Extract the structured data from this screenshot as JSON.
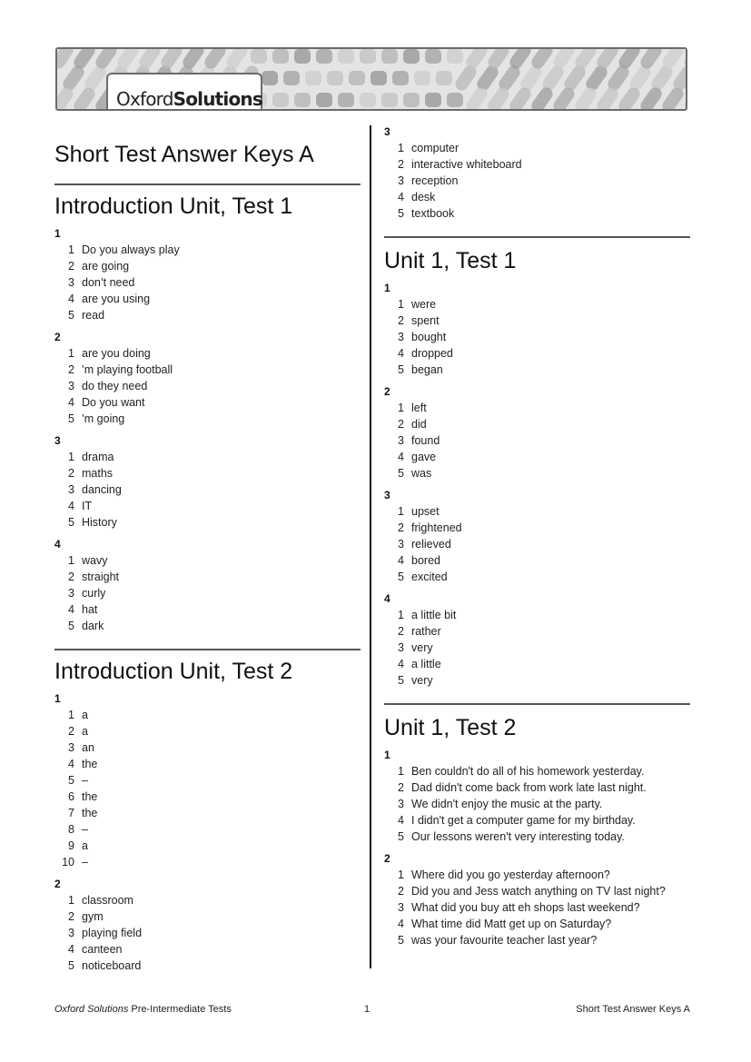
{
  "banner": {
    "brand_regular": "Oxford",
    "brand_bold": "Solutions"
  },
  "document": {
    "title": "Short Test Answer Keys A"
  },
  "sections": {
    "intro1": {
      "title": "Introduction Unit, Test 1",
      "q1": {
        "num": "1",
        "items": [
          [
            "1",
            "Do you always play"
          ],
          [
            "2",
            "are going"
          ],
          [
            "3",
            "don’t need"
          ],
          [
            "4",
            "are you using"
          ],
          [
            "5",
            "read"
          ]
        ]
      },
      "q2": {
        "num": "2",
        "items": [
          [
            "1",
            "are you doing"
          ],
          [
            "2",
            "’m playing football"
          ],
          [
            "3",
            "do they need"
          ],
          [
            "4",
            "Do you want"
          ],
          [
            "5",
            "’m going"
          ]
        ]
      },
      "q3": {
        "num": "3",
        "items": [
          [
            "1",
            "drama"
          ],
          [
            "2",
            "maths"
          ],
          [
            "3",
            "dancing"
          ],
          [
            "4",
            "IT"
          ],
          [
            "5",
            "History"
          ]
        ]
      },
      "q4": {
        "num": "4",
        "items": [
          [
            "1",
            "wavy"
          ],
          [
            "2",
            "straight"
          ],
          [
            "3",
            "curly"
          ],
          [
            "4",
            "hat"
          ],
          [
            "5",
            "dark"
          ]
        ]
      }
    },
    "intro2": {
      "title": "Introduction Unit, Test 2",
      "q1": {
        "num": "1",
        "items": [
          [
            "1",
            "a"
          ],
          [
            "2",
            "a"
          ],
          [
            "3",
            "an"
          ],
          [
            "4",
            "the"
          ],
          [
            "5",
            "–"
          ],
          [
            "6",
            "the"
          ],
          [
            "7",
            "the"
          ],
          [
            "8",
            "–"
          ],
          [
            "9",
            "a"
          ],
          [
            "10",
            "–"
          ]
        ]
      },
      "q2": {
        "num": "2",
        "items": [
          [
            "1",
            "classroom"
          ],
          [
            "2",
            "gym"
          ],
          [
            "3",
            "playing field"
          ],
          [
            "4",
            "canteen"
          ],
          [
            "5",
            "noticeboard"
          ]
        ]
      },
      "q3": {
        "num": "3",
        "items": [
          [
            "1",
            "computer"
          ],
          [
            "2",
            "interactive whiteboard"
          ],
          [
            "3",
            "reception"
          ],
          [
            "4",
            "desk"
          ],
          [
            "5",
            "textbook"
          ]
        ]
      }
    },
    "unit1test1": {
      "title": "Unit 1, Test 1",
      "q1": {
        "num": "1",
        "items": [
          [
            "1",
            "were"
          ],
          [
            "2",
            "spent"
          ],
          [
            "3",
            "bought"
          ],
          [
            "4",
            "dropped"
          ],
          [
            "5",
            "began"
          ]
        ]
      },
      "q2": {
        "num": "2",
        "items": [
          [
            "1",
            "left"
          ],
          [
            "2",
            "did"
          ],
          [
            "3",
            "found"
          ],
          [
            "4",
            "gave"
          ],
          [
            "5",
            "was"
          ]
        ]
      },
      "q3": {
        "num": "3",
        "items": [
          [
            "1",
            "upset"
          ],
          [
            "2",
            "frightened"
          ],
          [
            "3",
            "relieved"
          ],
          [
            "4",
            "bored"
          ],
          [
            "5",
            "excited"
          ]
        ]
      },
      "q4": {
        "num": "4",
        "items": [
          [
            "1",
            "a little bit"
          ],
          [
            "2",
            "rather"
          ],
          [
            "3",
            "very"
          ],
          [
            "4",
            "a little"
          ],
          [
            "5",
            "very"
          ]
        ]
      }
    },
    "unit1test2": {
      "title": "Unit 1, Test 2",
      "q1": {
        "num": "1",
        "items": [
          [
            "1",
            "Ben couldn't do all of his homework yesterday."
          ],
          [
            "2",
            "Dad didn't come back from work late last night."
          ],
          [
            "3",
            "We didn't enjoy the music at the party."
          ],
          [
            "4",
            "I didn't get a computer game for my birthday."
          ],
          [
            "5",
            "Our lessons weren't very interesting today."
          ]
        ]
      },
      "q2": {
        "num": "2",
        "items": [
          [
            "1",
            "Where did you go yesterday afternoon?"
          ],
          [
            "2",
            "Did you and Jess watch anything on TV last night?"
          ],
          [
            "3",
            "What did you buy att eh shops last weekend?"
          ],
          [
            "4",
            "What time did Matt get up on Saturday?"
          ],
          [
            "5",
            "was your favourite teacher last year?"
          ]
        ]
      }
    }
  },
  "footer": {
    "left_italic": "Oxford Solutions",
    "left_rest": " Pre-Intermediate Tests",
    "page": "1",
    "right": "Short Test Answer Keys A"
  }
}
